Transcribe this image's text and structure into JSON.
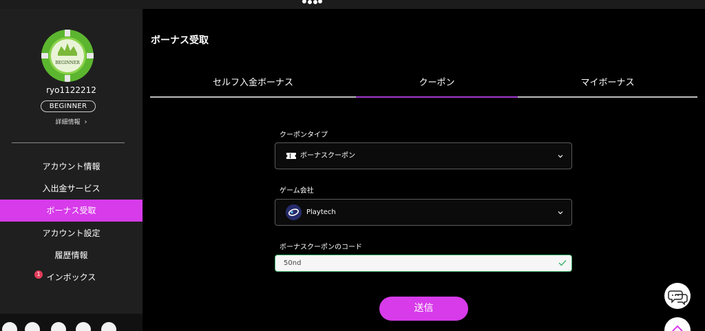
{
  "sidebar": {
    "avatar_text": "BEGINNER",
    "username": "ryo1122212",
    "rank": "BEGINNER",
    "detail_link": "詳細情報",
    "nav": [
      {
        "label": "アカウント情報"
      },
      {
        "label": "入出金サービス"
      },
      {
        "label": "ボーナス受取"
      },
      {
        "label": "アカウント設定"
      },
      {
        "label": "履歴情報"
      },
      {
        "label": "インボックス",
        "badge": "1"
      }
    ]
  },
  "main": {
    "title": "ボーナス受取",
    "tabs": [
      {
        "label": "セルフ入金ボーナス"
      },
      {
        "label": "クーポン"
      },
      {
        "label": "マイボーナス"
      }
    ],
    "active_tab": "クーポン",
    "coupon_type": {
      "label": "クーポンタイプ",
      "value": "ボーナスクーポン"
    },
    "game_provider": {
      "label": "ゲーム会社",
      "value": "Playtech"
    },
    "coupon_code": {
      "label": "ボーナスクーポンのコード",
      "value": "50nd"
    },
    "submit_label": "送信"
  },
  "colors": {
    "accent": "#d73bea",
    "tab_underline": "#a23bd1",
    "valid_border": "#3bb06a",
    "badge": "#e23c5a"
  },
  "icons": {
    "chat": "chat-bubble-icon",
    "scroll_top": "chevron-up-icon",
    "social": [
      "twitter-icon",
      "instagram-icon",
      "tiktok-icon",
      "youtube-icon",
      "lang-flag-icon"
    ]
  }
}
